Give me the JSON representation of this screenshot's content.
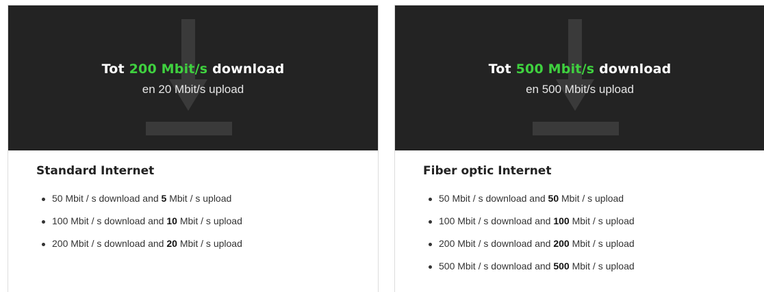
{
  "cards": [
    {
      "hero": {
        "prefix": "Tot",
        "download": "200 Mbit/s",
        "suffix": "download",
        "subline": "en 20 Mbit/s upload",
        "accent_color": "#3fd13f",
        "icon": "download-arrow-icon"
      },
      "title": "Standard Internet",
      "features": [
        {
          "pre": "50 Mbit / s download and",
          "bold": "5",
          "post": "Mbit / s upload"
        },
        {
          "pre": "100 Mbit / s download and",
          "bold": "10",
          "post": "Mbit / s upload"
        },
        {
          "pre": "200 Mbit / s download and",
          "bold": "20",
          "post": "Mbit / s upload"
        }
      ]
    },
    {
      "hero": {
        "prefix": "Tot",
        "download": "500 Mbit/s",
        "suffix": "download",
        "subline": "en 500 Mbit/s upload",
        "accent_color": "#3fd13f",
        "icon": "download-arrow-icon"
      },
      "title": "Fiber optic Internet",
      "features": [
        {
          "pre": "50 Mbit / s download and",
          "bold": "50",
          "post": "Mbit / s upload"
        },
        {
          "pre": "100 Mbit / s download and",
          "bold": "100",
          "post": "Mbit / s upload"
        },
        {
          "pre": "200 Mbit / s download and",
          "bold": "200",
          "post": "Mbit / s upload"
        },
        {
          "pre": "500 Mbit / s download and",
          "bold": "500",
          "post": "Mbit / s upload"
        }
      ]
    }
  ]
}
